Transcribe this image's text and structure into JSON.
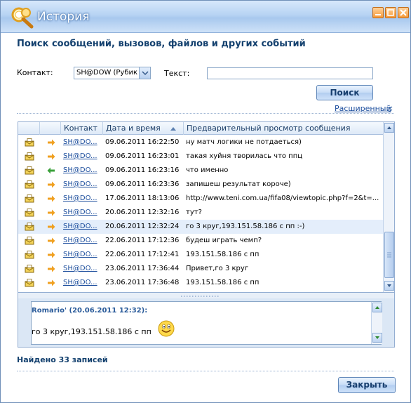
{
  "window": {
    "title": "История"
  },
  "heading": "Поиск сообщений, вызовов, файлов и других событий",
  "search": {
    "contact_label": "Контакт:",
    "contact_value": "SH@DOW (Рубик",
    "text_label": "Текст:",
    "text_value": "",
    "search_button": "Поиск",
    "advanced_link": "Расширенный"
  },
  "grid": {
    "columns": [
      "Контакт",
      "Дата и время",
      "Предварительный просмотр сообщения"
    ],
    "rows": [
      {
        "direction": "out",
        "contact": "SH@DO...",
        "datetime": "09.06.2011 16:22:50",
        "preview": "ну матч логики не потдаеться)"
      },
      {
        "direction": "out",
        "contact": "SH@DO...",
        "datetime": "09.06.2011 16:23:01",
        "preview": "такая хуйня творилась что ппц"
      },
      {
        "direction": "in",
        "contact": "SH@DO...",
        "datetime": "09.06.2011 16:23:16",
        "preview": "что именно"
      },
      {
        "direction": "out",
        "contact": "SH@DO...",
        "datetime": "09.06.2011 16:23:36",
        "preview": "запишеш результат короче)"
      },
      {
        "direction": "out",
        "contact": "SH@DO...",
        "datetime": "17.06.2011 18:13:06",
        "preview": "http://www.teni.com.ua/fifa08/viewtopic.php?f=2&t=..."
      },
      {
        "direction": "out",
        "contact": "SH@DO...",
        "datetime": "20.06.2011 12:32:16",
        "preview": "тут?"
      },
      {
        "direction": "out",
        "contact": "SH@DO...",
        "datetime": "20.06.2011 12:32:24",
        "preview": "го 3 круг,193.151.58.186 с пп :-)"
      },
      {
        "direction": "out",
        "contact": "SH@DO...",
        "datetime": "22.06.2011 17:12:36",
        "preview": "будеш играть чемп?"
      },
      {
        "direction": "out",
        "contact": "SH@DO...",
        "datetime": "22.06.2011 17:12:41",
        "preview": "193.151.58.186 с пп"
      },
      {
        "direction": "out",
        "contact": "SH@DO...",
        "datetime": "23.06.2011 17:36:44",
        "preview": "Привет,го 3 круг"
      },
      {
        "direction": "out",
        "contact": "SH@DO...",
        "datetime": "23.06.2011 17:36:48",
        "preview": "193.151.58.186 с пп"
      }
    ],
    "selected_index": 6
  },
  "preview_pane": {
    "header": "Romario' (20.06.2011 12:32):",
    "body": "го 3 круг,193.151.58.186 с пп"
  },
  "status": {
    "found": "Найдено 33 записей"
  },
  "footer": {
    "close_button": "Закрыть"
  },
  "colors": {
    "accent": "#13406e",
    "link": "#1a4c9c",
    "out_arrow": "#f0a020",
    "in_arrow": "#3aa03a"
  }
}
